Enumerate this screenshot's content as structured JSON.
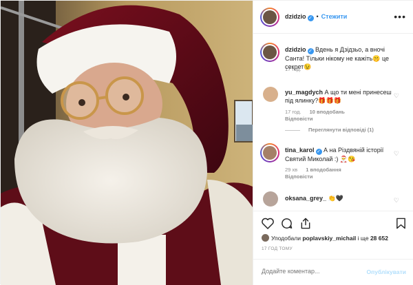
{
  "header": {
    "username": "dzidzio",
    "dot": "•",
    "follow_label": "Стежити",
    "more_label": "•••"
  },
  "caption": {
    "username": "dzidzio",
    "text": "Вдень я Дзідзьо, а вночі Санта! Тільки нікому не кажіть🤫 це секрет😉",
    "time": "17 год."
  },
  "comments": [
    {
      "username": "yu_magdych",
      "text": "А що ти мені принесеш під ялинку?🎁🎁🎁",
      "time": "17 год.",
      "likes": "10 вподобань",
      "reply": "Відповісти",
      "view_replies": "Переглянути відповіді (1)"
    },
    {
      "username": "tina_karol",
      "text": "А на Різдвяній історії Святий Миколай :) 🎅😘",
      "time": "29 хв",
      "likes": "1 вподобання",
      "reply": "Відповісти"
    },
    {
      "username": "oksana_grey_",
      "text": "👏🖤"
    }
  ],
  "likes": {
    "prefix": "Уподобали",
    "user": "poplavskiy_michail",
    "middle": "і ще",
    "count": "28 652"
  },
  "post_time": "17 ГОД ТОМУ",
  "add_comment": {
    "placeholder": "Додайте коментар...",
    "publish_label": "Опублікувати"
  },
  "colors": {
    "accent": "#3897f0",
    "muted": "#8e8e8e",
    "publish_disabled": "#b2dffc"
  },
  "icons": {
    "like": "heart-icon",
    "comment": "comment-icon",
    "share": "share-icon",
    "save": "bookmark-icon",
    "more": "more-icon",
    "verified": "verified-badge-icon"
  }
}
